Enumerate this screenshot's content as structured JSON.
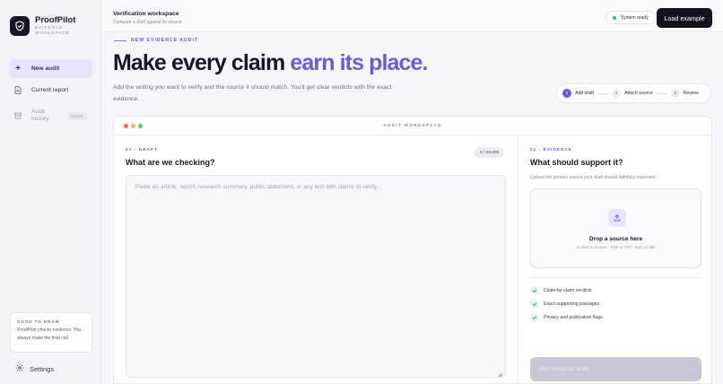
{
  "brand": {
    "name": "ProofPilot",
    "subtitle": "EVIDENCE WORKSPACE"
  },
  "sidebar": {
    "items": [
      {
        "label": "New audit",
        "icon": "plus-icon",
        "active": true
      },
      {
        "label": "Current report",
        "icon": "document-icon"
      },
      {
        "label": "Audit history",
        "icon": "archive-icon",
        "badge": "SOON",
        "disabled": true
      }
    ],
    "good_to_know": {
      "title": "GOOD TO KNOW",
      "text": "ProofPilot checks evidence. You always make the final call."
    },
    "settings_label": "Settings"
  },
  "topbar": {
    "title": "Verification workspace",
    "subtitle": "Compare a draft against its source",
    "status": "System ready",
    "status_color": "#2dbd72",
    "load_button": "Load example"
  },
  "hero": {
    "eyebrow": "NEW EVIDENCE AUDIT",
    "title_main": "Make every claim ",
    "title_accent": "earn its place.",
    "accent_color": "#6b5cd6",
    "description": "Add the writing you want to verify and the source it should match. You'll get clear verdicts with the exact evidence."
  },
  "stepper": [
    {
      "num": "1",
      "label": "Add draft",
      "active": true
    },
    {
      "num": "2",
      "label": "Attach source",
      "active": false
    },
    {
      "num": "3",
      "label": "Review",
      "active": false
    }
  ],
  "workspace": {
    "title": "AUDIT WORKSPACE",
    "draft": {
      "tag": "01 · DRAFT",
      "title": "What are we checking?",
      "counter": "0 / 20,000",
      "placeholder": "Paste an article, report, research summary, public statement, or any text with claims to verify..."
    },
    "evidence": {
      "tag": "02 · EVIDENCE",
      "title": "What should support it?",
      "subtitle": "Upload the primary source your draft should faithfully represent.",
      "drop_title": "Drop a source here",
      "drop_subtitle": "or click to browse · PDF or TXT · max 10 MB",
      "features": [
        "Claim-by-claim verdicts",
        "Exact supporting passages",
        "Privacy and publication flags"
      ],
      "run_button": "Run evidence audit"
    }
  }
}
